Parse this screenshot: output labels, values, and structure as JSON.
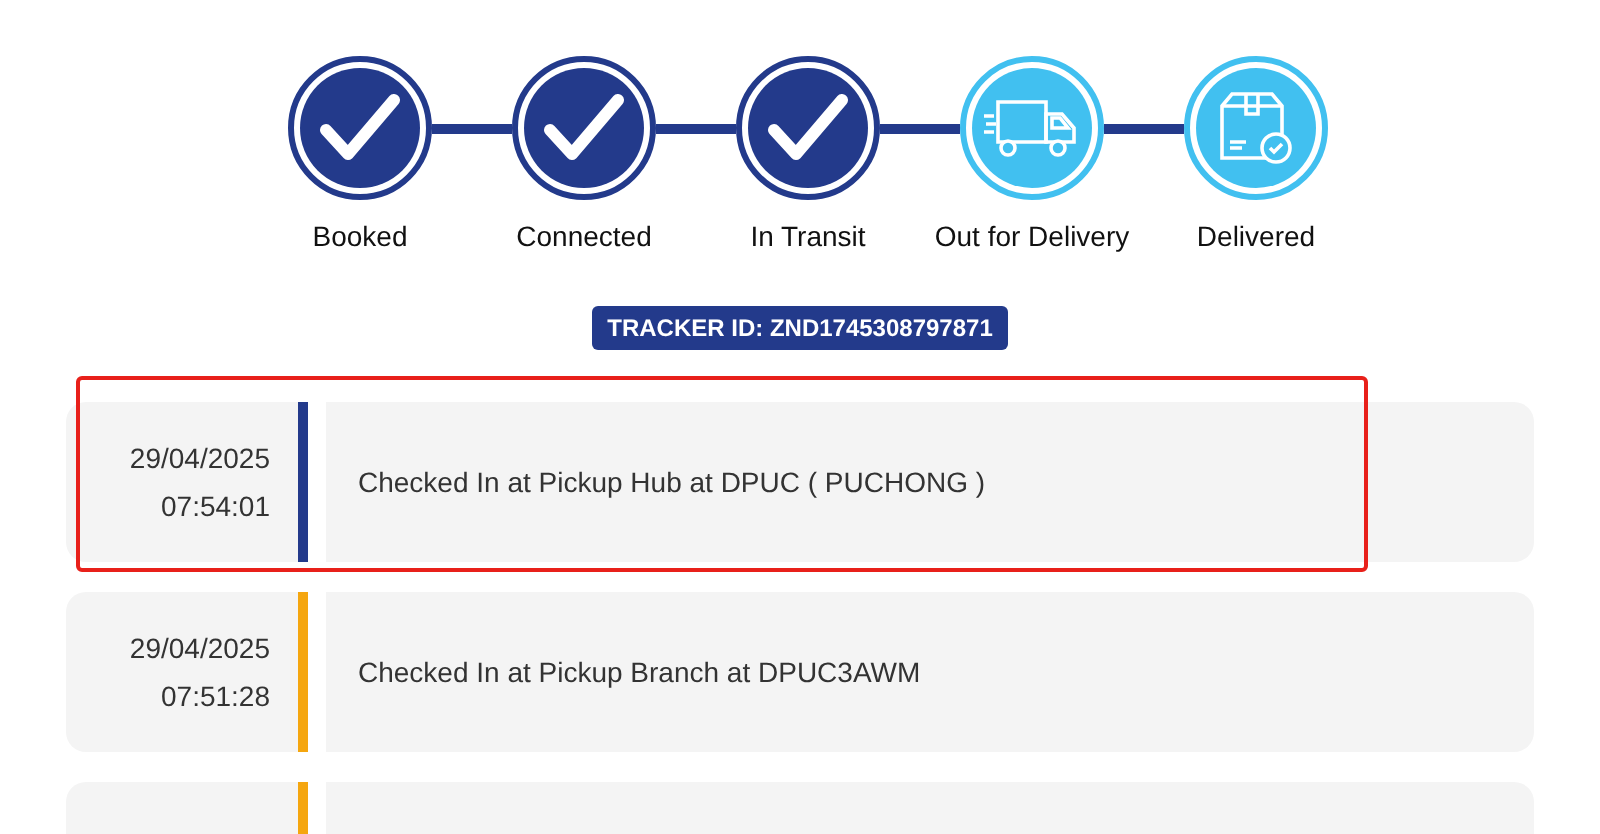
{
  "steps": [
    {
      "label": "Booked",
      "kind": "check",
      "done": true
    },
    {
      "label": "Connected",
      "kind": "check",
      "done": true
    },
    {
      "label": "In Transit",
      "kind": "check",
      "done": true
    },
    {
      "label": "Out for Delivery",
      "kind": "truck",
      "done": false
    },
    {
      "label": "Delivered",
      "kind": "package",
      "done": false
    }
  ],
  "tracker_id": "TRACKER ID: ZND1745308797871",
  "events": [
    {
      "date": "29/04/2025",
      "time": "07:54:01",
      "text": "Checked In at Pickup Hub at DPUC ( PUCHONG )",
      "color": "#233a8b",
      "highlighted": true
    },
    {
      "date": "29/04/2025",
      "time": "07:51:28",
      "text": "Checked In at Pickup Branch at DPUC3AWM",
      "color": "#f5a60f",
      "highlighted": false
    },
    {
      "color": "#f5a60f",
      "highlighted": false
    }
  ]
}
